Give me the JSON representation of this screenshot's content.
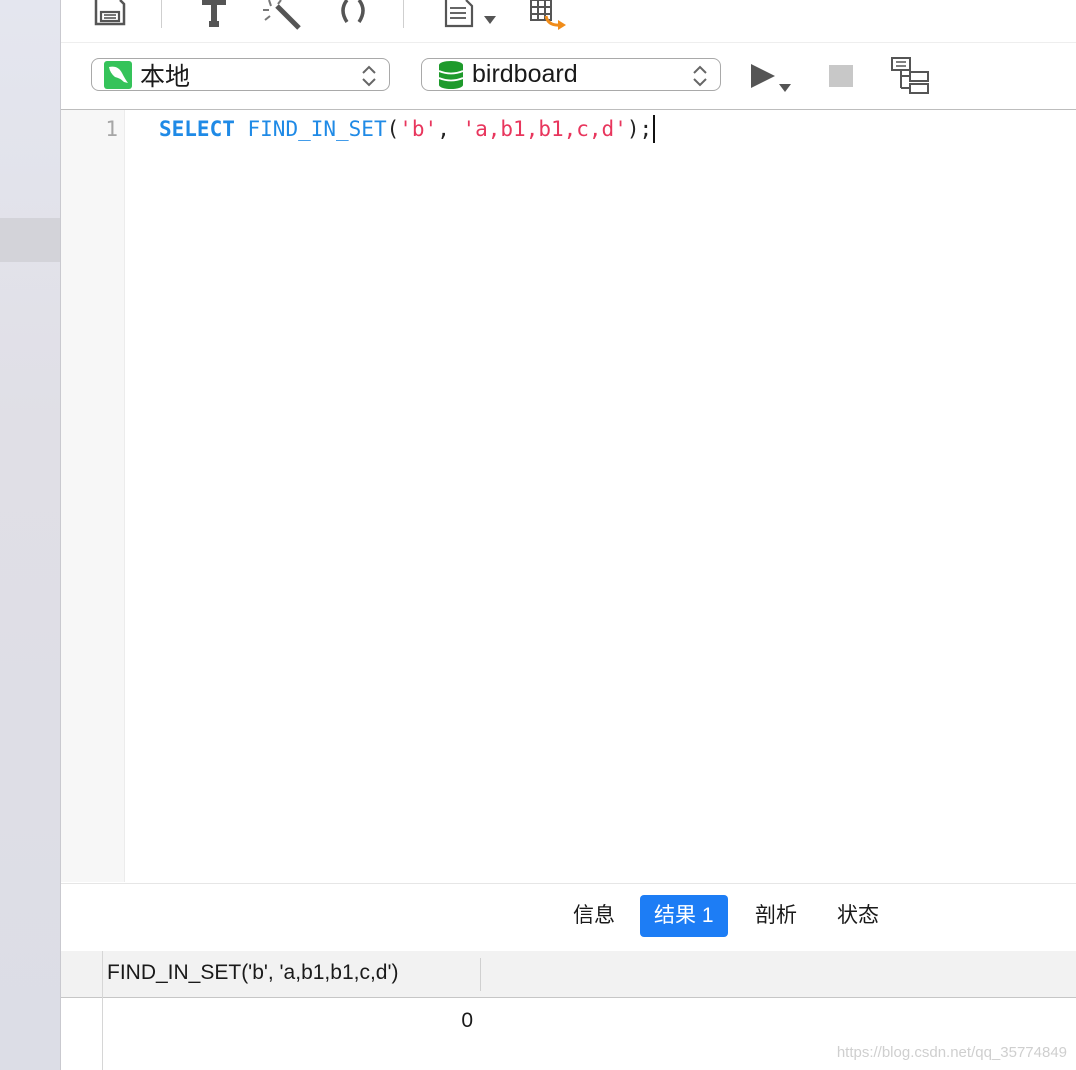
{
  "toolbar": {
    "icons": [
      "save-icon",
      "pin-icon",
      "magic-wand-icon",
      "parentheses-icon",
      "document-icon",
      "table-export-icon"
    ]
  },
  "connection_select": {
    "value": "本地"
  },
  "database_select": {
    "value": "birdboard"
  },
  "editor": {
    "line_number": "1",
    "keyword": "SELECT",
    "function": "FIND_IN_SET",
    "open_paren": "(",
    "arg1": "'b'",
    "comma": ", ",
    "arg2": "'a,b1,b1,c,d'",
    "close": ");"
  },
  "result_tabs": [
    {
      "label": "信息",
      "active": false
    },
    {
      "label": "结果 1",
      "active": true
    },
    {
      "label": "剖析",
      "active": false
    },
    {
      "label": "状态",
      "active": false
    }
  ],
  "result_grid": {
    "columns": [
      "FIND_IN_SET('b', 'a,b1,b1,c,d')"
    ],
    "rows": [
      [
        "0"
      ]
    ]
  },
  "watermark": "https://blog.csdn.net/qq_35774849",
  "colors": {
    "accent": "#1d7df5",
    "keyword": "#1f8ae6",
    "string": "#e8365d"
  }
}
